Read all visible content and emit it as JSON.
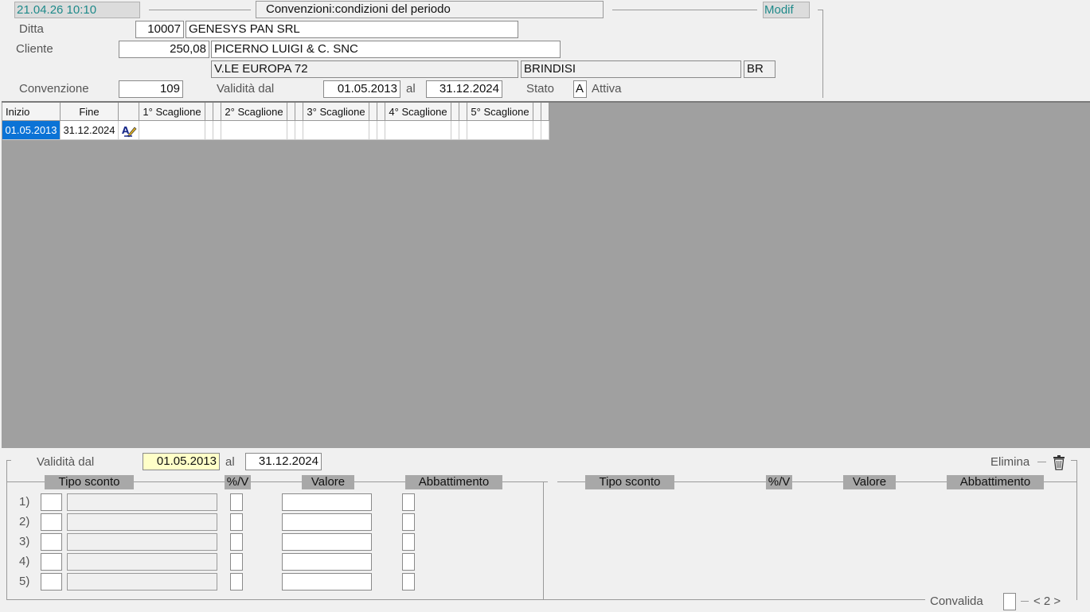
{
  "header": {
    "datetime": "21.04.26 10:10",
    "title": "Convenzioni:condizioni del periodo",
    "mode": "Modif"
  },
  "form": {
    "ditta_label": "Ditta",
    "ditta_code": "10007",
    "ditta_name": "GENESYS PAN SRL",
    "cliente_label": "Cliente",
    "cliente_code": "250,08",
    "cliente_name": "PICERNO LUIGI & C. SNC",
    "address": "V.LE EUROPA 72",
    "city": "BRINDISI",
    "province": "BR",
    "convenzione_label": "Convenzione",
    "convenzione_code": "109",
    "validita_label": "Validità dal",
    "validita_from": "01.05.2013",
    "al_label": "al",
    "validita_to": "31.12.2024",
    "stato_label": "Stato",
    "stato_code": "A",
    "stato_text": "Attiva"
  },
  "grid": {
    "headers": [
      "Inizio",
      "Fine",
      "",
      "1° Scaglione",
      "2° Scaglione",
      "3° Scaglione",
      "4° Scaglione",
      "5° Scaglione"
    ],
    "row": {
      "inizio": "01.05.2013",
      "fine": "31.12.2024"
    }
  },
  "detail": {
    "validita_label": "Validità dal",
    "validita_from": "01.05.2013",
    "al_label": "al",
    "validita_to": "31.12.2024",
    "elimina_label": "Elimina",
    "col_tipo": "Tipo sconto",
    "col_pv": "%/V",
    "col_valore": "Valore",
    "col_abbatt": "Abbattimento",
    "row_labels": [
      "1)",
      "2)",
      "3)",
      "4)",
      "5)"
    ],
    "convalida_label": "Convalida",
    "pager": "< 2 >"
  },
  "icons": {
    "row_edit": "edit-pencil-icon",
    "delete": "trash-icon"
  },
  "colors": {
    "selection": "#0b73d6",
    "teal_text": "#1f8a8a",
    "grid_bg": "#a0a0a0",
    "yellow_field": "#ffffc8"
  }
}
